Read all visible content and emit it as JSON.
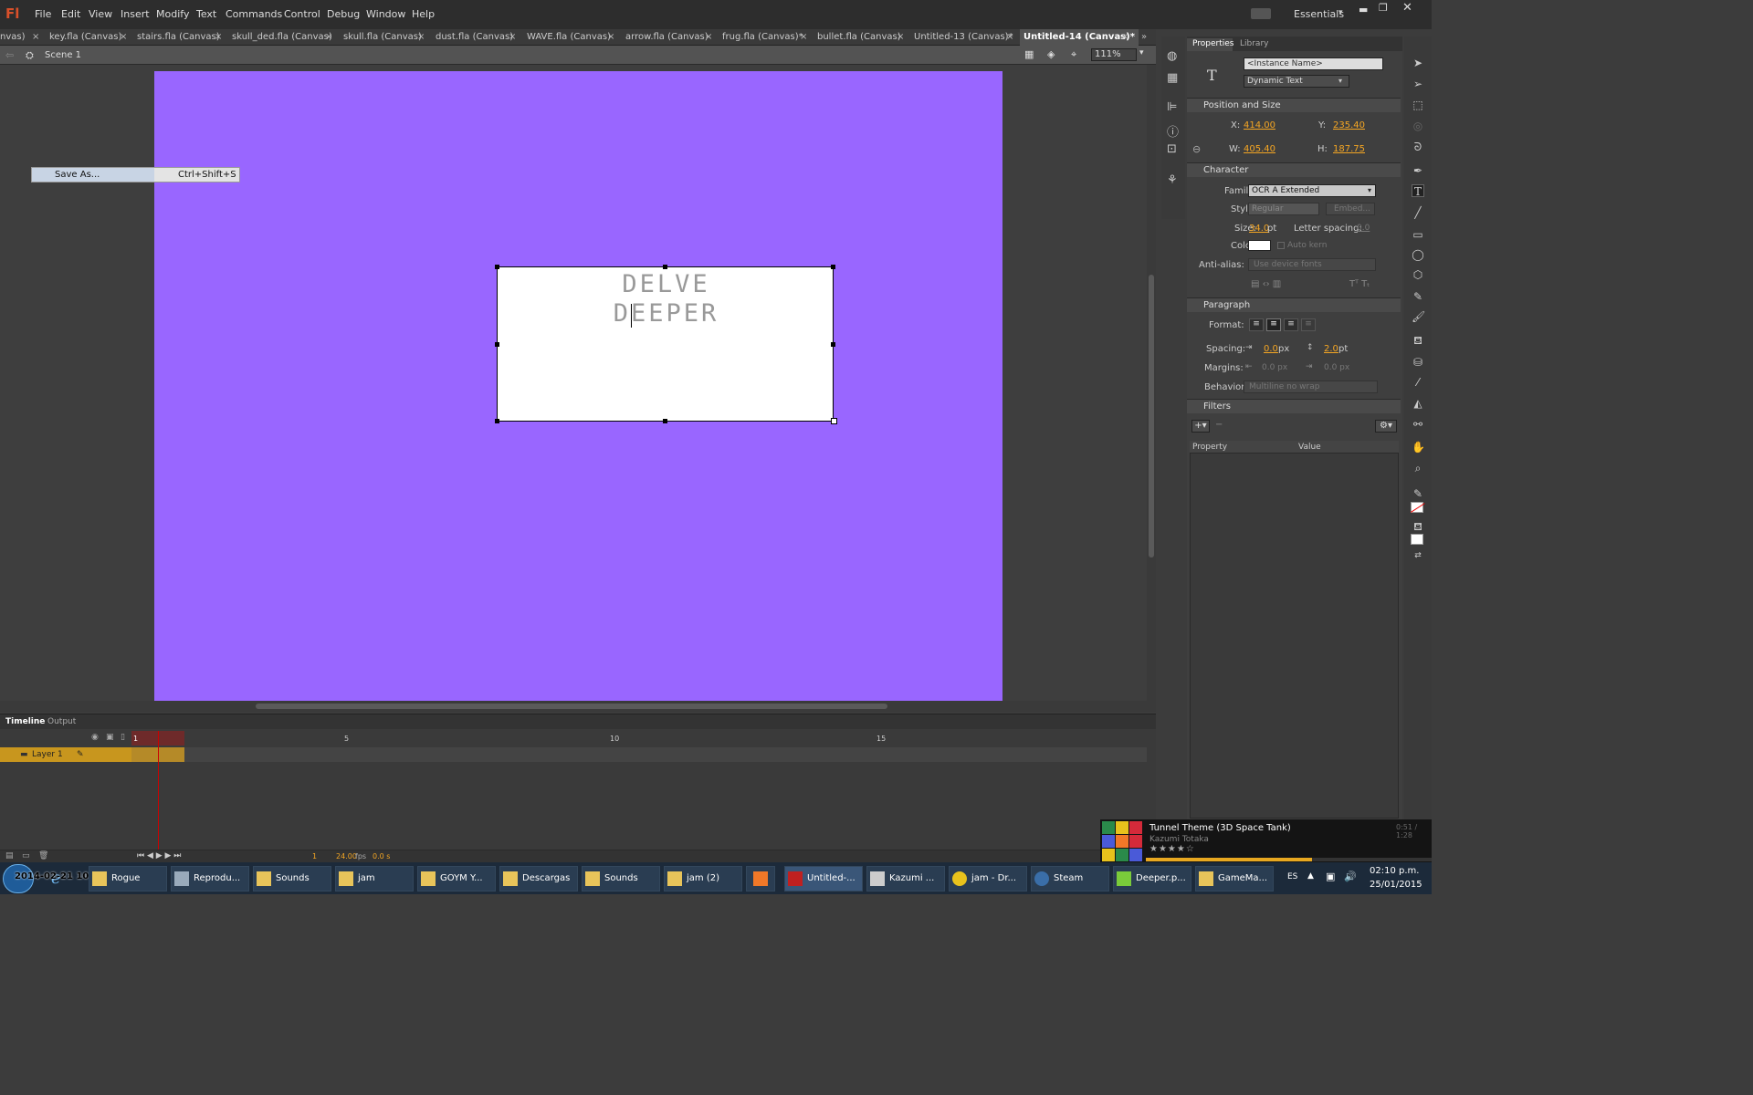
{
  "app": {
    "logo": "Fl",
    "workspace": "Essentials"
  },
  "menu": [
    "File",
    "Edit",
    "View",
    "Insert",
    "Modify",
    "Text",
    "Commands",
    "Control",
    "Debug",
    "Window",
    "Help"
  ],
  "tabs": [
    "nvas)",
    "key.fla (Canvas)",
    "stairs.fla (Canvas)",
    "skull_ded.fla (Canvas)",
    "skull.fla (Canvas)",
    "dust.fla (Canvas)",
    "WAVE.fla (Canvas)",
    "arrow.fla (Canvas)",
    "frug.fla (Canvas)*",
    "bullet.fla (Canvas)",
    "Untitled-13 (Canvas)*",
    "Untitled-14 (Canvas)*"
  ],
  "editbar": {
    "scene": "Scene 1",
    "zoom": "111%"
  },
  "stage": {
    "line1": "DELVE",
    "line2": "DEEPER",
    "stage_color": "#9966ff"
  },
  "context_menu": {
    "label": "Save As...",
    "shortcut": "Ctrl+Shift+S"
  },
  "timeline": {
    "tabs": [
      "Timeline",
      "Output"
    ],
    "layer": "Layer 1",
    "frames": [
      "1",
      "5",
      "10",
      "15"
    ],
    "frame": "1",
    "fps": "24.00",
    "fps_unit": "fps",
    "time": "0.0 s"
  },
  "properties": {
    "tabs": [
      "Properties",
      "Library"
    ],
    "instance_name": "<Instance Name>",
    "text_type": "Dynamic Text",
    "position_size": {
      "title": "Position and Size",
      "x_label": "X:",
      "x": "414.00",
      "y_label": "Y:",
      "y": "235.40",
      "w_label": "W:",
      "w": "405.40",
      "h_label": "H:",
      "h": "187.75"
    },
    "character": {
      "title": "Character",
      "family_label": "Family:",
      "family": "OCR A Extended",
      "style_label": "Style:",
      "style": "Regular",
      "embed": "Embed...",
      "size_label": "Size:",
      "size": "34.0",
      "size_unit": "pt",
      "letter_spacing_label": "Letter spacing:",
      "letter_spacing": "0.0",
      "color_label": "Color:",
      "autokern": "Auto kern",
      "antialias_label": "Anti-alias:",
      "antialias": "Use device fonts"
    },
    "paragraph": {
      "title": "Paragraph",
      "format_label": "Format:",
      "spacing_label": "Spacing:",
      "spacing1": "0.0",
      "spacing1_unit": "px",
      "spacing2": "2.0",
      "spacing2_unit": "pt",
      "margins_label": "Margins:",
      "margin1": "0.0 px",
      "margin2": "0.0 px",
      "behavior_label": "Behavior:",
      "behavior": "Multiline no wrap"
    },
    "filters": {
      "title": "Filters",
      "col_property": "Property",
      "col_value": "Value"
    }
  },
  "music": {
    "title": "Tunnel Theme (3D Space Tank)",
    "artist": "Kazumi Totaka",
    "time": "0:51 / 1:28"
  },
  "taskbar": {
    "overlay_text": "2014-02-21 10:55:37",
    "items": [
      "Rogue",
      "Reprodu...",
      "Sounds",
      "jam",
      "GOYM Y...",
      "Descargas",
      "Sounds",
      "jam (2)",
      "",
      "Untitled-...",
      "Kazumi ...",
      "jam - Dr...",
      "Steam",
      "Deeper.p...",
      "GameMa..."
    ],
    "lang": "ES",
    "time": "02:10 p.m.",
    "date": "25/01/2015"
  }
}
